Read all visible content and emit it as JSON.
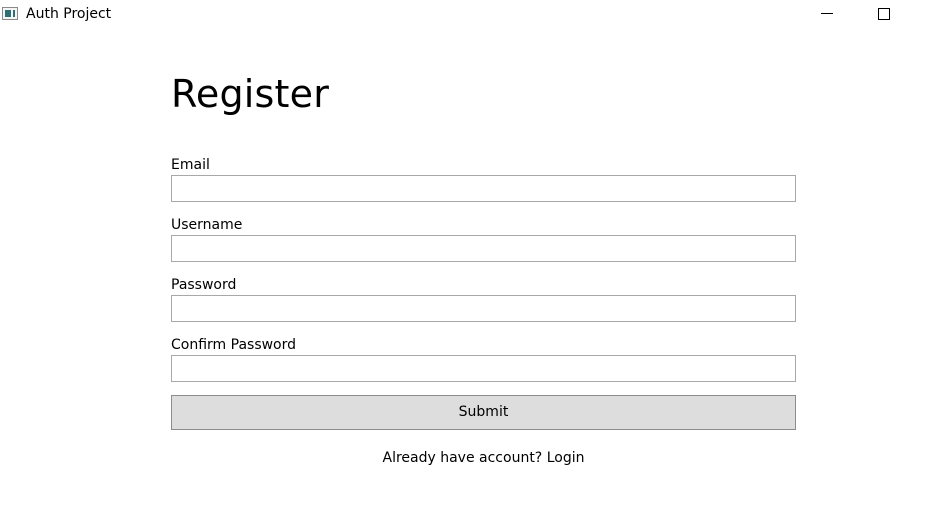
{
  "window": {
    "title": "Auth Project",
    "icon": "app-window-icon",
    "controls": {
      "minimize_icon": "minimize-icon",
      "maximize_icon": "maximize-icon"
    }
  },
  "form": {
    "title": "Register",
    "fields": [
      {
        "label": "Email",
        "value": "",
        "placeholder": ""
      },
      {
        "label": "Username",
        "value": "",
        "placeholder": ""
      },
      {
        "label": "Password",
        "value": "",
        "placeholder": ""
      },
      {
        "label": "Confirm Password",
        "value": "",
        "placeholder": ""
      }
    ],
    "submit_label": "Submit",
    "login_prompt": "Already have account?",
    "login_link": "Login"
  },
  "colors": {
    "background": "#ffffff",
    "input_border": "#a8a8a8",
    "button_background": "#dddddd",
    "button_border": "#8c8c8c",
    "text": "#000000"
  }
}
